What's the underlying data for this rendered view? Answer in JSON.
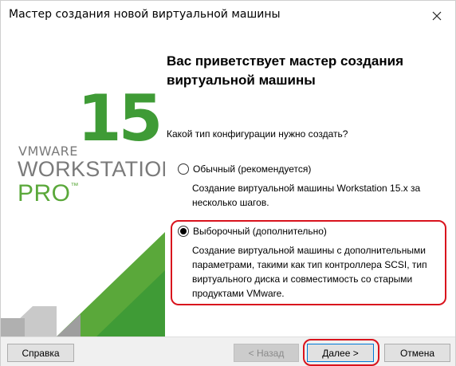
{
  "window": {
    "title": "Мастер создания новой виртуальной машины"
  },
  "brand": {
    "version": "15",
    "vendor": "VMWARE",
    "product": "WORKSTATION",
    "edition": "PRO",
    "trademark": "™",
    "colors": {
      "green": "#3f9b36",
      "grey": "#7a7a7a"
    }
  },
  "content": {
    "heading": "Вас приветствует мастер создания виртуальной машины",
    "question": "Какой тип конфигурации нужно создать?",
    "options": [
      {
        "label": "Обычный (рекомендуется)",
        "description": "Создание виртуальной машины Workstation 15.x за несколько шагов.",
        "selected": false
      },
      {
        "label": "Выборочный (дополнительно)",
        "description": "Создание виртуальной машины с дополнительными параметрами, такими как тип контроллера SCSI, тип виртуального диска и совместимость со старыми продуктами VMware.",
        "selected": true
      }
    ]
  },
  "buttons": {
    "help": "Справка",
    "back": "< Назад",
    "next": "Далее >",
    "cancel": "Отмена"
  },
  "highlight_color": "#d9131d"
}
